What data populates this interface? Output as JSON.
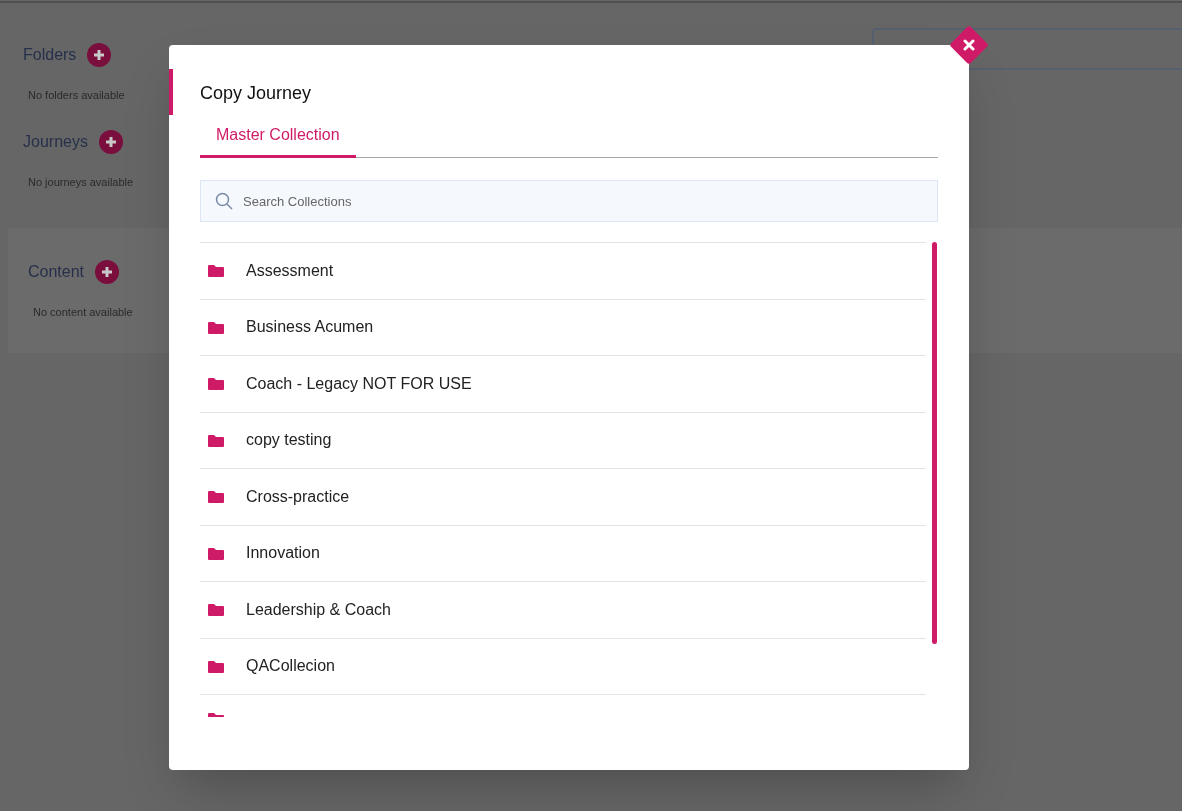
{
  "background": {
    "sections": [
      {
        "title": "Folders",
        "empty_text": "No folders available"
      },
      {
        "title": "Journeys",
        "empty_text": "No journeys available"
      },
      {
        "title": "Content",
        "empty_text": "No content available"
      }
    ]
  },
  "dialog": {
    "title": "Copy Journey",
    "tabs": [
      {
        "label": "Master Collection",
        "selected": true
      }
    ],
    "search": {
      "placeholder": "Search Collections"
    },
    "collections": [
      {
        "label": "Assessment"
      },
      {
        "label": "Business Acumen"
      },
      {
        "label": "Coach - Legacy NOT FOR USE"
      },
      {
        "label": "copy testing"
      },
      {
        "label": "Cross-practice"
      },
      {
        "label": "Innovation"
      },
      {
        "label": "Leadership & Coach"
      },
      {
        "label": "QACollecion"
      }
    ]
  }
}
